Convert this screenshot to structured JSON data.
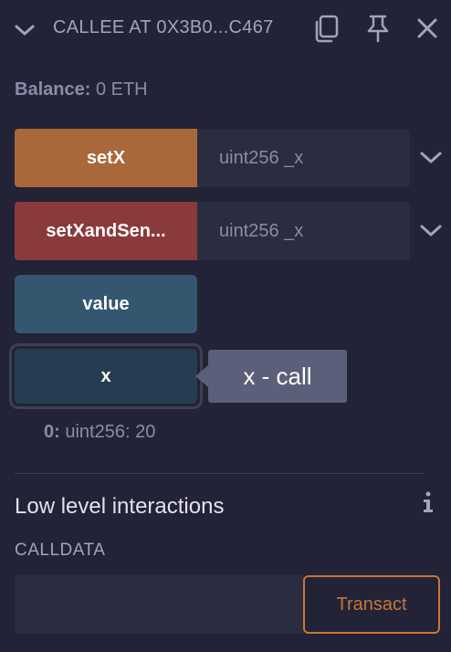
{
  "header": {
    "title": "CALLEE AT 0X3B0...C467",
    "icons": [
      "chevron-down-icon",
      "copy-icon",
      "pin-icon",
      "close-icon"
    ]
  },
  "balance": {
    "label": "Balance:",
    "value": "0 ETH"
  },
  "functions": [
    {
      "label": "setX",
      "placeholder": "uint256 _x",
      "color": "#a8683a"
    },
    {
      "label": "setXandSen...",
      "placeholder": "uint256 _x",
      "color": "#8b3a3c"
    }
  ],
  "value_button": {
    "label": "value",
    "color": "#34576f"
  },
  "x_button": {
    "label": "x",
    "color": "#263d51"
  },
  "tooltip": {
    "text": "x - call"
  },
  "result": {
    "index": "0:",
    "value": "uint256: 20"
  },
  "low_level": {
    "title": "Low level interactions",
    "calldata_label": "CALLDATA",
    "calldata_value": "",
    "transact_label": "Transact"
  },
  "colors": {
    "background": "#222336",
    "input_bg": "#2a2c3f",
    "accent_orange": "#c97539",
    "text_muted": "#a2a3bd"
  }
}
